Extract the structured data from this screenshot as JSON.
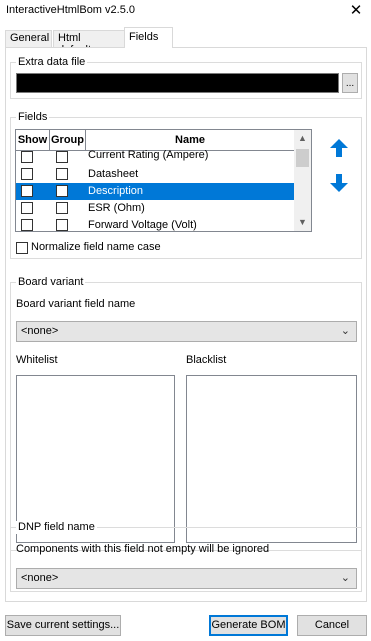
{
  "window": {
    "title": "InteractiveHtmlBom v2.5.0",
    "close_glyph": "✕"
  },
  "tabs": [
    {
      "label": "General",
      "active": false
    },
    {
      "label": "Html defaults",
      "active": false
    },
    {
      "label": "Fields",
      "active": true
    }
  ],
  "extra_data_file": {
    "legend": "Extra data file",
    "value": "",
    "browse_label": "..."
  },
  "fields": {
    "legend": "Fields",
    "columns": [
      "Show",
      "Group",
      "Name"
    ],
    "rows": [
      {
        "name": "Current Rating (Ampere)",
        "show": false,
        "group": false,
        "selected": false
      },
      {
        "name": "Datasheet",
        "show": false,
        "group": false,
        "selected": false
      },
      {
        "name": "Description",
        "show": false,
        "group": false,
        "selected": true
      },
      {
        "name": "ESR (Ohm)",
        "show": false,
        "group": false,
        "selected": false
      },
      {
        "name": "Forward Voltage (Volt)",
        "show": false,
        "group": false,
        "selected": false
      }
    ],
    "move_up_icon": "arrow-up-icon",
    "move_down_icon": "arrow-down-icon",
    "accent_color": "#0078d7",
    "normalize_label": "Normalize field name case",
    "normalize_checked": false
  },
  "board_variant": {
    "legend": "Board variant",
    "field_name_label": "Board variant field name",
    "field_name_value": "<none>",
    "whitelist_label": "Whitelist",
    "blacklist_label": "Blacklist"
  },
  "dnp": {
    "legend": "DNP field name",
    "description": "Components with this field not empty will be ignored",
    "value": "<none>"
  },
  "footer": {
    "save_label": "Save current settings...",
    "generate_label": "Generate BOM",
    "cancel_label": "Cancel"
  }
}
